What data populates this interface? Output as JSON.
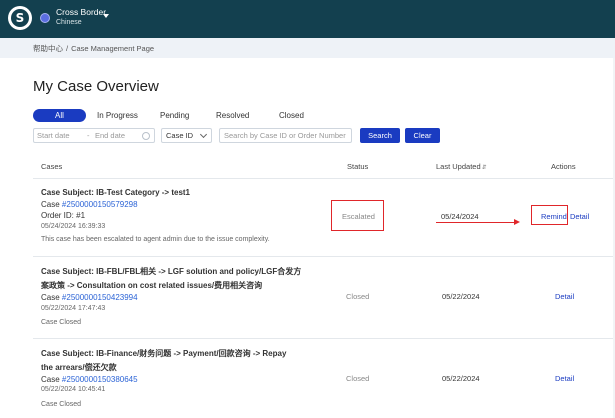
{
  "header": {
    "logo_letter": "S",
    "region_title": "Cross Border",
    "region_subtitle": "Chinese"
  },
  "breadcrumb": {
    "home": "帮助中心",
    "separator": "/",
    "current": "Case Management Page"
  },
  "page_title": "My Case Overview",
  "tabs": [
    {
      "label": "All",
      "active": true
    },
    {
      "label": "In Progress",
      "active": false
    },
    {
      "label": "Pending",
      "active": false
    },
    {
      "label": "Resolved",
      "active": false
    },
    {
      "label": "Closed",
      "active": false
    }
  ],
  "filters": {
    "start_placeholder": "Start date",
    "range_dash": "-",
    "end_placeholder": "End date",
    "search_by_selected": "Case ID",
    "search_placeholder": "Search by Case ID or Order Number",
    "search_button": "Search",
    "clear_button": "Clear"
  },
  "table": {
    "headers": {
      "cases": "Cases",
      "status": "Status",
      "last_updated": "Last Updated",
      "actions": "Actions"
    },
    "rows": [
      {
        "subject": "Case Subject: IB-Test Category -> test1",
        "case_prefix": "Case",
        "case_id": "#2500000150579298",
        "order_id": "Order ID: #1",
        "created": "05/24/2024 16:39:33",
        "note": "This case has been escalated to agent admin due to the issue complexity.",
        "status": "Escalated",
        "last_updated": "05/24/2024",
        "actions": [
          "Remind",
          "Detail"
        ]
      },
      {
        "subject_line1": "Case Subject: IB-FBL/FBL相关 -> LGF solution and policy/LGF合发方",
        "subject_line2": "案政策 -> Consultation on cost related issues/费用相关咨询",
        "case_prefix": "Case",
        "case_id": "#2500000150423994",
        "created": "05/22/2024 17:47:43",
        "note": "Case Closed",
        "status": "Closed",
        "last_updated": "05/22/2024",
        "actions": [
          "Detail"
        ]
      },
      {
        "subject_line1": "Case Subject: IB-Finance/财务问题 -> Payment/回款咨询 -> Repay",
        "subject_line2": "the arrears/偿还欠款",
        "case_prefix": "Case",
        "case_id": "#2500000150380645",
        "created": "05/22/2024 10:45:41",
        "note": "Case Closed",
        "status": "Closed",
        "last_updated": "05/22/2024",
        "actions": [
          "Detail"
        ]
      }
    ]
  },
  "colors": {
    "topbar": "#13404f",
    "primary": "#1a3bc1",
    "link": "#2b63d6",
    "highlight": "#e0262a"
  }
}
